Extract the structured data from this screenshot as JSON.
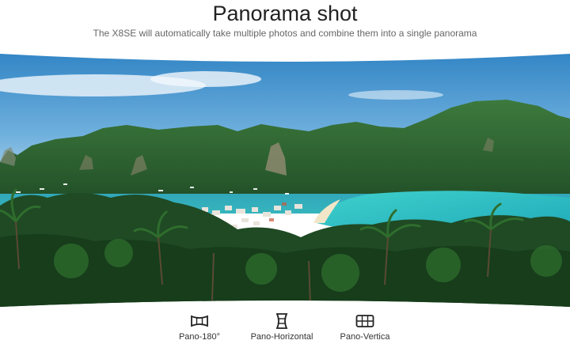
{
  "header": {
    "title": "Panorama shot",
    "subtitle": "The X8SE will automatically take multiple photos and combine them into a single panorama"
  },
  "image": {
    "description_icon": "panorama-photo",
    "colors": {
      "sky_top": "#3a8cc9",
      "sky_bottom": "#bcd9ee",
      "lagoon": "#2bc0c4",
      "sea": "#2e8fb0",
      "mountain": "#2f6a36",
      "jungle": "#1e4a22"
    }
  },
  "modes": [
    {
      "icon": "pano-180-icon",
      "label": "Pano-180°"
    },
    {
      "icon": "pano-horizontal-icon",
      "label": "Pano-Horizontal"
    },
    {
      "icon": "pano-vertical-icon",
      "label": "Pano-Vertica"
    }
  ]
}
